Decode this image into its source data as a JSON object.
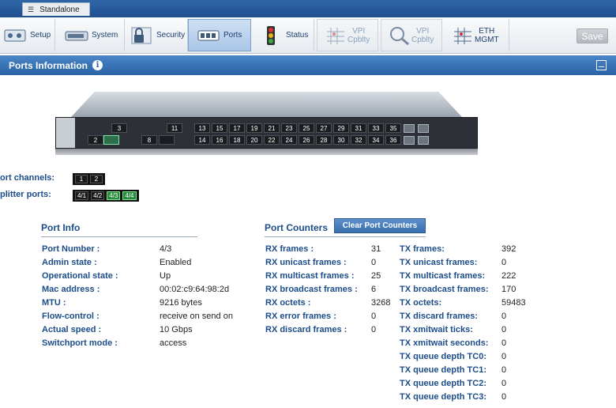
{
  "topbar": {
    "standalone_label": "Standalone"
  },
  "toolbar": {
    "items": [
      {
        "label": "Setup",
        "icon": "setup-icon"
      },
      {
        "label": "System",
        "icon": "system-icon"
      },
      {
        "label": "Security",
        "icon": "security-icon"
      },
      {
        "label": "Ports",
        "icon": "ports-icon",
        "active": true
      },
      {
        "label": "Status",
        "icon": "status-icon"
      },
      {
        "label_line1": "VPI",
        "label_line2": "Cpblty",
        "icon": "vpi-grid-icon",
        "disabled": true
      },
      {
        "label_line1": "VPI",
        "label_line2": "Cpblty",
        "icon": "vpi-search-icon",
        "disabled": true
      },
      {
        "label_line1": "ETH",
        "label_line2": "MGMT",
        "icon": "eth-mgmt-icon"
      }
    ],
    "save_label": "Save"
  },
  "panel": {
    "title": "Ports Information",
    "info_glyph": "i"
  },
  "switch": {
    "top_row": [
      "3",
      "",
      "11",
      "13",
      "15",
      "17",
      "19",
      "21",
      "23",
      "25",
      "27",
      "29",
      "31",
      "33",
      "35"
    ],
    "bottom_row": [
      "2",
      "",
      "8",
      "",
      "14",
      "16",
      "18",
      "20",
      "22",
      "24",
      "26",
      "28",
      "30",
      "32",
      "34",
      "36"
    ]
  },
  "channels": {
    "port_channels_label": "ort channels:",
    "port_channels": [
      "1",
      "2"
    ],
    "splitter_ports_label": "plitter ports:",
    "splitter_ports": [
      {
        "label": "4/1",
        "highlight": false
      },
      {
        "label": "4/2",
        "highlight": false
      },
      {
        "label": "4/3",
        "highlight": true
      },
      {
        "label": "4/4",
        "highlight": true
      }
    ]
  },
  "port_info": {
    "title": "Port Info",
    "rows": [
      {
        "key": "Port Number :",
        "value": "4/3"
      },
      {
        "key": "Admin state :",
        "value": "Enabled"
      },
      {
        "key": "Operational state :",
        "value": "Up"
      },
      {
        "key": "Mac address :",
        "value": "00:02:c9:64:98:2d"
      },
      {
        "key": "MTU :",
        "value": "9216 bytes"
      },
      {
        "key": "Flow-control :",
        "value": "receive on send on"
      },
      {
        "key": "Actual speed :",
        "value": "10 Gbps"
      },
      {
        "key": "Switchport mode :",
        "value": "access"
      }
    ]
  },
  "port_counters": {
    "title": "Port Counters",
    "clear_label": "Clear Port Counters",
    "rx": [
      {
        "key": "RX frames :",
        "value": "31"
      },
      {
        "key": "RX unicast frames :",
        "value": "0"
      },
      {
        "key": "RX multicast frames :",
        "value": "25"
      },
      {
        "key": "RX broadcast frames :",
        "value": "6"
      },
      {
        "key": "RX octets :",
        "value": "3268"
      },
      {
        "key": "RX error frames :",
        "value": "0"
      },
      {
        "key": "RX discard frames :",
        "value": "0"
      }
    ],
    "tx": [
      {
        "key": "TX frames:",
        "value": "392"
      },
      {
        "key": "TX unicast frames:",
        "value": "0"
      },
      {
        "key": "TX multicast frames:",
        "value": "222"
      },
      {
        "key": "TX broadcast frames:",
        "value": "170"
      },
      {
        "key": "TX octets:",
        "value": "59483"
      },
      {
        "key": "TX discard frames:",
        "value": "0"
      },
      {
        "key": "TX xmitwait ticks:",
        "value": "0"
      },
      {
        "key": "TX xmitwait seconds:",
        "value": "0"
      },
      {
        "key": "TX queue depth TC0:",
        "value": "0"
      },
      {
        "key": "TX queue depth TC1:",
        "value": "0"
      },
      {
        "key": "TX queue depth TC2:",
        "value": "0"
      },
      {
        "key": "TX queue depth TC3:",
        "value": "0"
      }
    ]
  }
}
